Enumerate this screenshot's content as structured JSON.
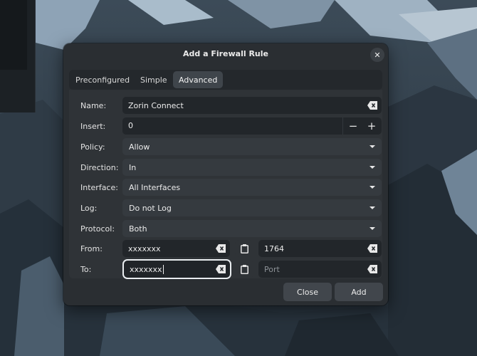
{
  "dialog": {
    "title": "Add a Firewall Rule",
    "close_glyph": "✕"
  },
  "tabs": [
    {
      "label": "Preconfigured"
    },
    {
      "label": "Simple"
    },
    {
      "label": "Advanced",
      "active": true
    }
  ],
  "form": {
    "name": {
      "label": "Name:",
      "value": "Zorin Connect"
    },
    "insert": {
      "label": "Insert:",
      "value": "0",
      "decrement": "−",
      "increment": "+"
    },
    "policy": {
      "label": "Policy:",
      "value": "Allow"
    },
    "direction": {
      "label": "Direction:",
      "value": "In"
    },
    "interface": {
      "label": "Interface:",
      "value": "All Interfaces"
    },
    "log": {
      "label": "Log:",
      "value": "Do not Log"
    },
    "protocol": {
      "label": "Protocol:",
      "value": "Both"
    },
    "from": {
      "label": "From:",
      "address": "xxxxxxx",
      "port": "1764"
    },
    "to": {
      "label": "To:",
      "address": "xxxxxxx",
      "port_placeholder": "Port"
    }
  },
  "buttons": {
    "close": "Close",
    "add": "Add"
  },
  "icons": {
    "clear": "edit-clear-icon",
    "paste": "clipboard-icon",
    "dropdown": "chevron-down-icon",
    "close": "close-icon"
  },
  "colors": {
    "dialog_bg": "#2a2e32",
    "field_bg": "#22262a",
    "combo_bg": "#353a3f",
    "focus_ring": "#e9edf0"
  }
}
